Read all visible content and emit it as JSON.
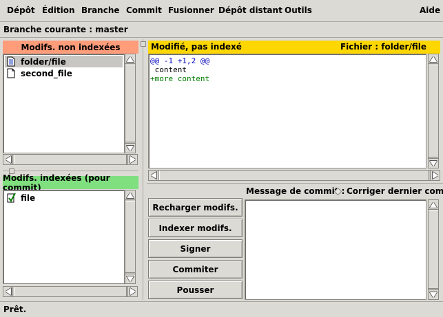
{
  "menubar": {
    "items": [
      "Dépôt",
      "Édition",
      "Branche",
      "Commit",
      "Fusionner",
      "Dépôt distant",
      "Outils"
    ],
    "help": "Aide"
  },
  "branch": {
    "label": "Branche courante : master"
  },
  "unstaged": {
    "header": "Modifs. non indexées",
    "header_color": "#ff9c7a",
    "files": [
      {
        "name": "folder/file",
        "icon": "modified-file-icon",
        "selected": true
      },
      {
        "name": "second_file",
        "icon": "new-file-icon",
        "selected": false
      }
    ]
  },
  "staged": {
    "header": "Modifs. indexées (pour commit)",
    "header_color": "#80e080",
    "files": [
      {
        "name": "file",
        "icon": "staged-check-icon"
      }
    ]
  },
  "diff": {
    "header_left": "Modifié, pas indexé",
    "header_right": "Fichier :  folder/file",
    "header_color": "#ffd700",
    "lines": [
      {
        "text": "@@ -1 +1,2 @@",
        "color": "#0000c0"
      },
      {
        "text": " content",
        "color": "#000000"
      },
      {
        "text": "+more content",
        "color": "#008000"
      }
    ]
  },
  "commit": {
    "message_label": "Message de commit :",
    "amend_label": "Corriger dernier commit",
    "buttons": [
      "Recharger modifs.",
      "Indexer modifs.",
      "Signer",
      "Commiter",
      "Pousser"
    ]
  },
  "status": {
    "text": "Prêt."
  }
}
